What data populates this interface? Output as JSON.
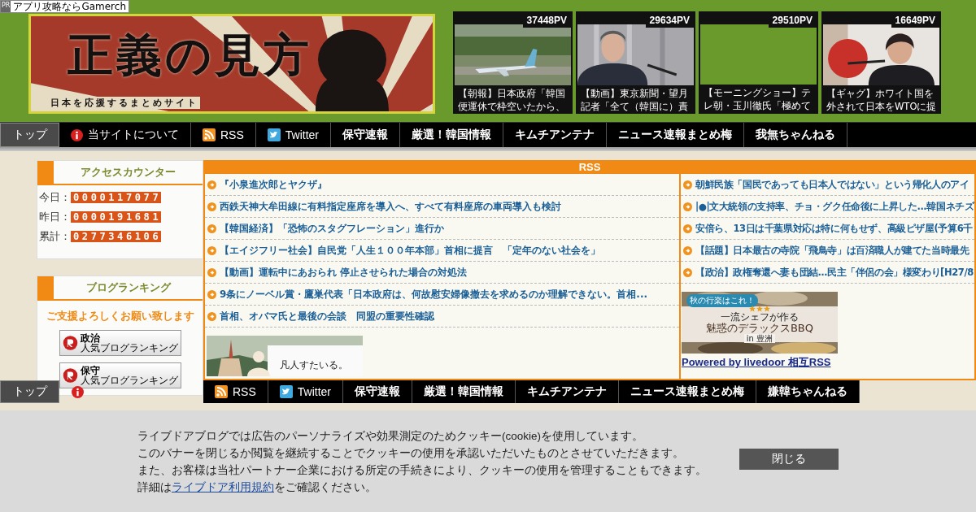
{
  "ad_tag": {
    "label": "PR",
    "text": "アプリ攻略ならGamerch"
  },
  "logo": {
    "title": "正義の見方",
    "subtitle": "日本を応援するまとめサイト"
  },
  "popular": [
    {
      "views": "37448PV",
      "caption": "【朝報】日本政府「韓国便運休で枠空いたから、",
      "kind": "plane"
    },
    {
      "views": "29634PV",
      "caption": "【動画】東京新聞・望月記者「全て（韓国に）責",
      "kind": "speaker"
    },
    {
      "views": "29510PV",
      "caption": "【モーニングショー】テレ朝・玉川徹氏「極めて",
      "kind": "blank"
    },
    {
      "views": "16649PV",
      "caption": "【ギャグ】ホワイト国を外されて日本をWTOに提",
      "kind": "flag"
    }
  ],
  "nav": [
    {
      "kind": "top",
      "label": "トップ"
    },
    {
      "kind": "info",
      "label": "当サイトについて"
    },
    {
      "kind": "rss",
      "label": "RSS"
    },
    {
      "kind": "twitter",
      "label": "Twitter"
    },
    {
      "kind": "link",
      "label": "保守速報"
    },
    {
      "kind": "link",
      "label": "厳選！韓国情報"
    },
    {
      "kind": "link",
      "label": "キムチアンテナ"
    },
    {
      "kind": "link",
      "label": "ニュース速報まとめ梅"
    },
    {
      "kind": "link",
      "label": "我無ちゃんねる"
    }
  ],
  "sidebar": {
    "counter": {
      "title": "アクセスカウンター",
      "rows": [
        {
          "label": "今日：",
          "value": "0000117077"
        },
        {
          "label": "昨日：",
          "value": "0000191681"
        },
        {
          "label": "累計：",
          "value": "0277346106"
        }
      ]
    },
    "ranking": {
      "title": "ブログランキング",
      "message": "ご支援よろしくお願い致します",
      "buttons": [
        {
          "category": "政治",
          "caption": "人気ブログランキング"
        },
        {
          "category": "保守",
          "caption": "人気ブログランキング"
        }
      ]
    }
  },
  "rss": {
    "title": "RSS",
    "left": [
      "『小泉進次郎とヤクザ』",
      "西鉄天神大牟田線に有料指定座席を導入へ、すべて有料座席の車両導入も検討",
      "【韓国経済】「恐怖のスタグフレーション」進行か",
      "【エイジフリー社会】自民党「人生１００年本部」首相に提言　「定年のない社会を」",
      "【動画】運転中にあおられ 停止させられた場合の対処法",
      "9条にノーベル賞・鷹巣代表「日本政府は、何故慰安婦像撤去を求めるのか理解できない。首相...",
      "首相、オバマ氏と最後の会談　同盟の重要性確認"
    ],
    "left_ad": {
      "caption": "凡人すたいる。"
    },
    "right": [
      "朝鮮民族「国民であっても日本人ではない」という帰化人のアイ",
      "|●|文大統領の支持率、チョ・グク任命後に上昇した...韓国ネチズ",
      "安倍ら、13日は千葉県対応は特に何もせず、高級ピザ屋(予算6千",
      "【話題】日本最古の寺院「飛鳥寺」は百済職人が建てた当時最先",
      "【政治】政権奪還へ妻も団結…民主「伴侶の会」様変わり[H27/8"
    ],
    "right_ad": {
      "badge": "秋の行楽はこれ！",
      "stars": 3,
      "tagline": "一流シェフが作る",
      "headline": "魅惑のデラックスBBQ",
      "place": "in 豊洲"
    },
    "powered": "Powered by livedoor 相互RSS"
  },
  "bottom_nav": [
    {
      "kind": "top",
      "label": "トップ"
    },
    {
      "kind": "info"
    },
    {
      "kind": "rss",
      "label": "RSS"
    },
    {
      "kind": "twitter",
      "label": "Twitter"
    },
    {
      "kind": "link",
      "label": "保守速報"
    },
    {
      "kind": "link",
      "label": "厳選！韓国情報"
    },
    {
      "kind": "link",
      "label": "キムチアンテナ"
    },
    {
      "kind": "link",
      "label": "ニュース速報まとめ梅"
    },
    {
      "kind": "link",
      "label": "嫌韓ちゃんねる"
    }
  ],
  "cookie_banner": {
    "lines": [
      "ライブドアブログでは広告のパーソナライズや効果測定のためクッキー(cookie)を使用しています。",
      "このバナーを閉じるか閲覧を継続することでクッキーの使用を承認いただいたものとさせていただきます。",
      "また、お客様は当社パートナー企業における所定の手続きにより、クッキーの使用を管理することもできます。"
    ],
    "detail_before": "詳細は",
    "link": "ライブドア利用規約",
    "detail_after": "をご確認ください。",
    "close": "閉じる"
  }
}
